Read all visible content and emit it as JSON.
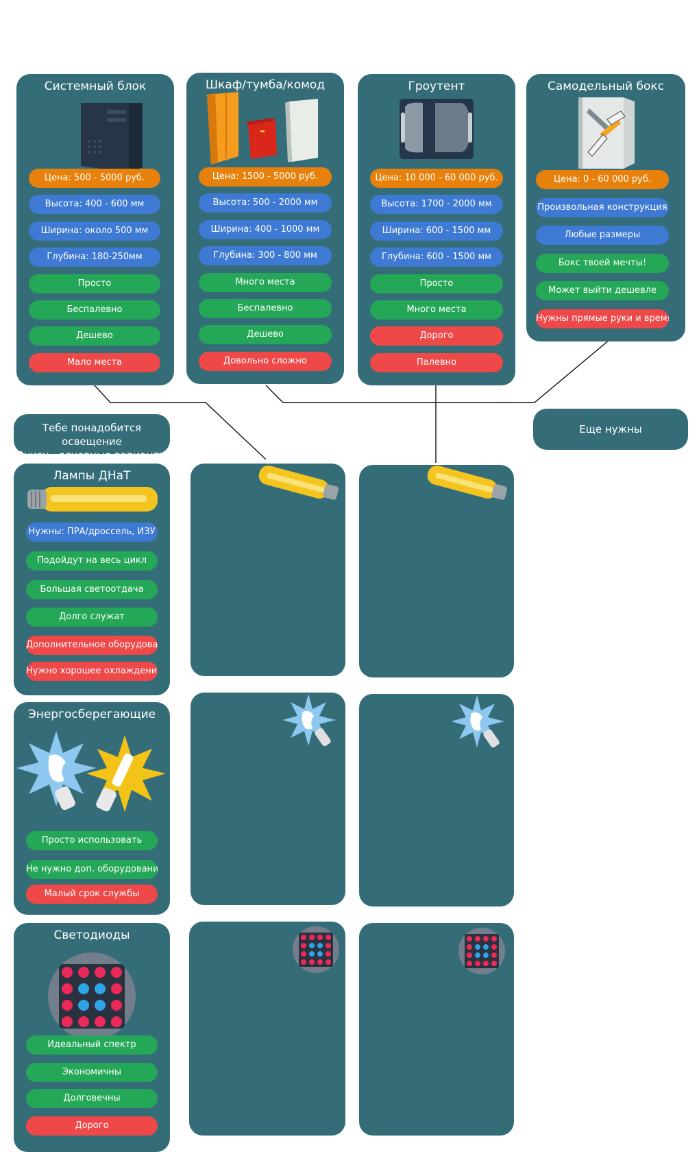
{
  "boxes": [
    {
      "title": "Системный блок",
      "icon": "pc-case-icon",
      "items": [
        {
          "label": "Цена: 500 - 5000 руб.",
          "color": "orange"
        },
        {
          "label": "Высота: 400 - 600 мм",
          "color": "blue"
        },
        {
          "label": "Ширина: около 500 мм",
          "color": "blue"
        },
        {
          "label": "Глубина: 180-250мм",
          "color": "blue"
        },
        {
          "label": "Просто",
          "color": "green"
        },
        {
          "label": "Беспалевно",
          "color": "green"
        },
        {
          "label": "Дешево",
          "color": "green"
        },
        {
          "label": "Мало места",
          "color": "red"
        }
      ]
    },
    {
      "title": "Шкаф/тумба/комод",
      "icon": "furniture-icon",
      "items": [
        {
          "label": "Цена: 1500 - 5000 руб.",
          "color": "orange"
        },
        {
          "label": "Высота: 500 - 2000 мм",
          "color": "blue"
        },
        {
          "label": "Ширина: 400 - 1000 мм",
          "color": "blue"
        },
        {
          "label": "Глубина: 300 - 800 мм",
          "color": "blue"
        },
        {
          "label": "Много места",
          "color": "green"
        },
        {
          "label": "Беспалевно",
          "color": "green"
        },
        {
          "label": "Дешево",
          "color": "green"
        },
        {
          "label": "Довольно сложно",
          "color": "red"
        }
      ]
    },
    {
      "title": "Гроутент",
      "icon": "growtent-icon",
      "items": [
        {
          "label": "Цена: 10 000 - 60 000 руб.",
          "color": "orange"
        },
        {
          "label": "Высота: 1700 - 2000 мм",
          "color": "blue"
        },
        {
          "label": "Ширина: 600 - 1500 мм",
          "color": "blue"
        },
        {
          "label": "Глубина: 600 - 1500 мм",
          "color": "blue"
        },
        {
          "label": "Просто",
          "color": "green"
        },
        {
          "label": "Много места",
          "color": "green"
        },
        {
          "label": "Дорого",
          "color": "red"
        },
        {
          "label": "Палевно",
          "color": "red"
        }
      ]
    },
    {
      "title": "Самодельный бокс",
      "icon": "diy-box-icon",
      "items": [
        {
          "label": "Цена: 0 - 60 000 руб.",
          "color": "orange"
        },
        {
          "label": "Произвольная конструкция",
          "color": "blue"
        },
        {
          "label": "Любые размеры",
          "color": "blue"
        },
        {
          "label": "Бокс твоей мечты!",
          "color": "green"
        },
        {
          "label": "Может выйти дешевле",
          "color": "green"
        },
        {
          "label": "Нужны прямые руки и время",
          "color": "red"
        }
      ]
    }
  ],
  "lighting_note": {
    "line1": "Тебе понадобится освещение",
    "line2": "Внизу - основные варианты"
  },
  "more_note": "Еще нужны",
  "lamps": [
    {
      "title": "Лампы ДНаТ",
      "icon": "hps-lamp-icon",
      "items": [
        {
          "label": "Нужны: ПРА/дроссель, ИЗУ",
          "color": "blue"
        },
        {
          "label": "Подойдут на весь цикл",
          "color": "green"
        },
        {
          "label": "Большая светоотдача",
          "color": "green"
        },
        {
          "label": "Долго служат",
          "color": "green"
        },
        {
          "label": "Дополнительное оборудование",
          "color": "red"
        },
        {
          "label": "Нужно хорошее охлаждение",
          "color": "red"
        }
      ]
    },
    {
      "title": "Энергосберегающие",
      "icon": "cfl-lamp-icon",
      "items": [
        {
          "label": "Просто использовать",
          "color": "green"
        },
        {
          "label": "Не нужно доп. оборудование",
          "color": "green"
        },
        {
          "label": "Малый срок службы",
          "color": "red"
        }
      ]
    },
    {
      "title": "Светодиоды",
      "icon": "led-matrix-icon",
      "items": [
        {
          "label": "Идеальный спектр",
          "color": "green"
        },
        {
          "label": "Экономичны",
          "color": "green"
        },
        {
          "label": "Долговечны",
          "color": "green"
        },
        {
          "label": "Дорого",
          "color": "red"
        }
      ]
    }
  ],
  "colors": {
    "card": "#346d78",
    "orange": "#e8810b",
    "blue": "#3e7ad3",
    "green": "#24a857",
    "red": "#ef4848"
  }
}
